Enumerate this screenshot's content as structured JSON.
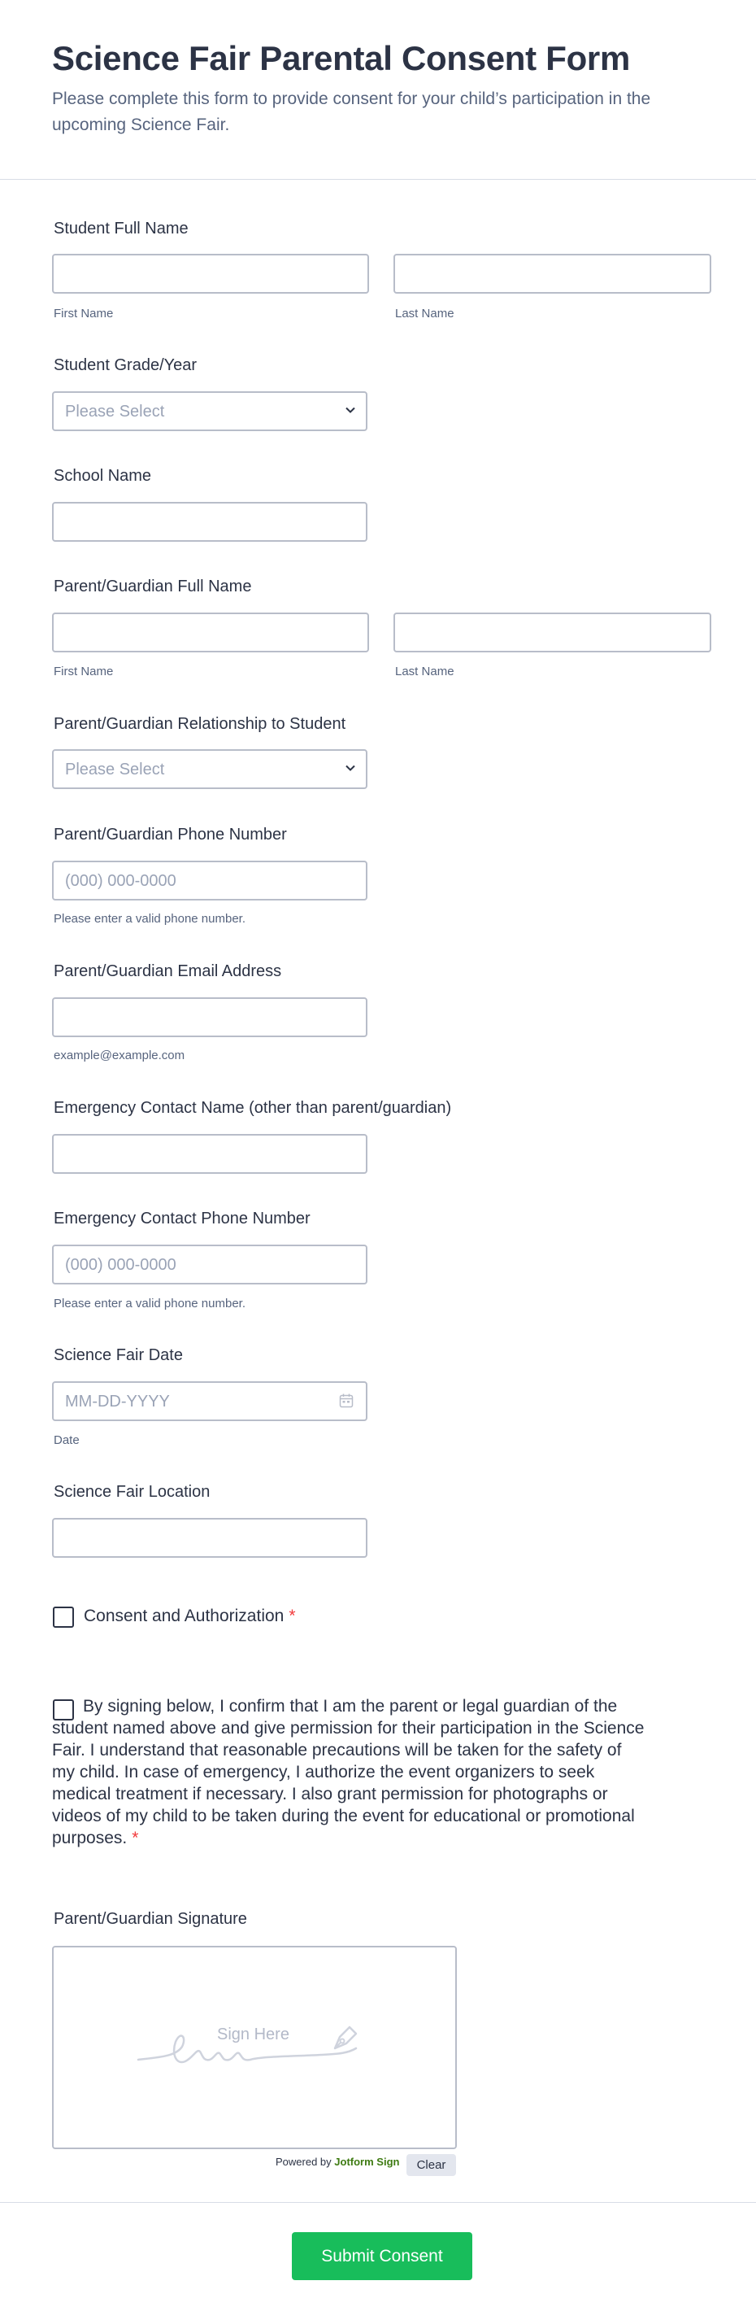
{
  "form": {
    "title": "Science Fair Parental Consent Form",
    "subtitle": "Please complete this form to provide consent for your child’s participation in the upcoming Science Fair."
  },
  "student_name": {
    "label": "Student Full Name",
    "first_sub": "First Name",
    "last_sub": "Last Name"
  },
  "grade": {
    "label": "Student Grade/Year",
    "placeholder": "Please Select"
  },
  "school": {
    "label": "School Name"
  },
  "parent_name": {
    "label": "Parent/Guardian Full Name",
    "first_sub": "First Name",
    "last_sub": "Last Name"
  },
  "relationship": {
    "label": "Parent/Guardian Relationship to Student",
    "placeholder": "Please Select"
  },
  "parent_phone": {
    "label": "Parent/Guardian Phone Number",
    "placeholder": "(000) 000-0000",
    "sub": "Please enter a valid phone number."
  },
  "parent_email": {
    "label": "Parent/Guardian Email Address",
    "sub": "example@example.com"
  },
  "emergency_name": {
    "label": "Emergency Contact Name (other than parent/guardian)"
  },
  "emergency_phone": {
    "label": "Emergency Contact Phone Number",
    "placeholder": "(000) 000-0000",
    "sub": "Please enter a valid phone number."
  },
  "fair_date": {
    "label": "Science Fair Date",
    "placeholder": "MM-DD-YYYY",
    "sub": "Date"
  },
  "fair_location": {
    "label": "Science Fair Location"
  },
  "consent": {
    "label": "Consent and Authorization",
    "required_mark": "*"
  },
  "statement": {
    "text": "By signing below, I confirm that I am the parent or legal guardian of the student named above and give permission for their participation in the Science Fair. I understand that reasonable precautions will be taken for the safety of my child. In case of emergency, I authorize the event organizers to seek medical treatment if necessary. I also grant permission for photographs or videos of my child to be taken during the event for educational or promotional purposes.",
    "required_mark": "*"
  },
  "signature": {
    "label": "Parent/Guardian Signature",
    "sign_here": "Sign Here",
    "powered_prefix": "Powered by",
    "powered_brand": "Jotform Sign",
    "clear_label": "Clear"
  },
  "submit": {
    "label": "Submit Consent"
  },
  "colors": {
    "submit": "#18bd5b",
    "required": "#f23a3c",
    "brand": "#3e7b12"
  },
  "icons": [
    "chevron-down-icon",
    "calendar-icon",
    "pen-icon",
    "signature-squiggle"
  ]
}
